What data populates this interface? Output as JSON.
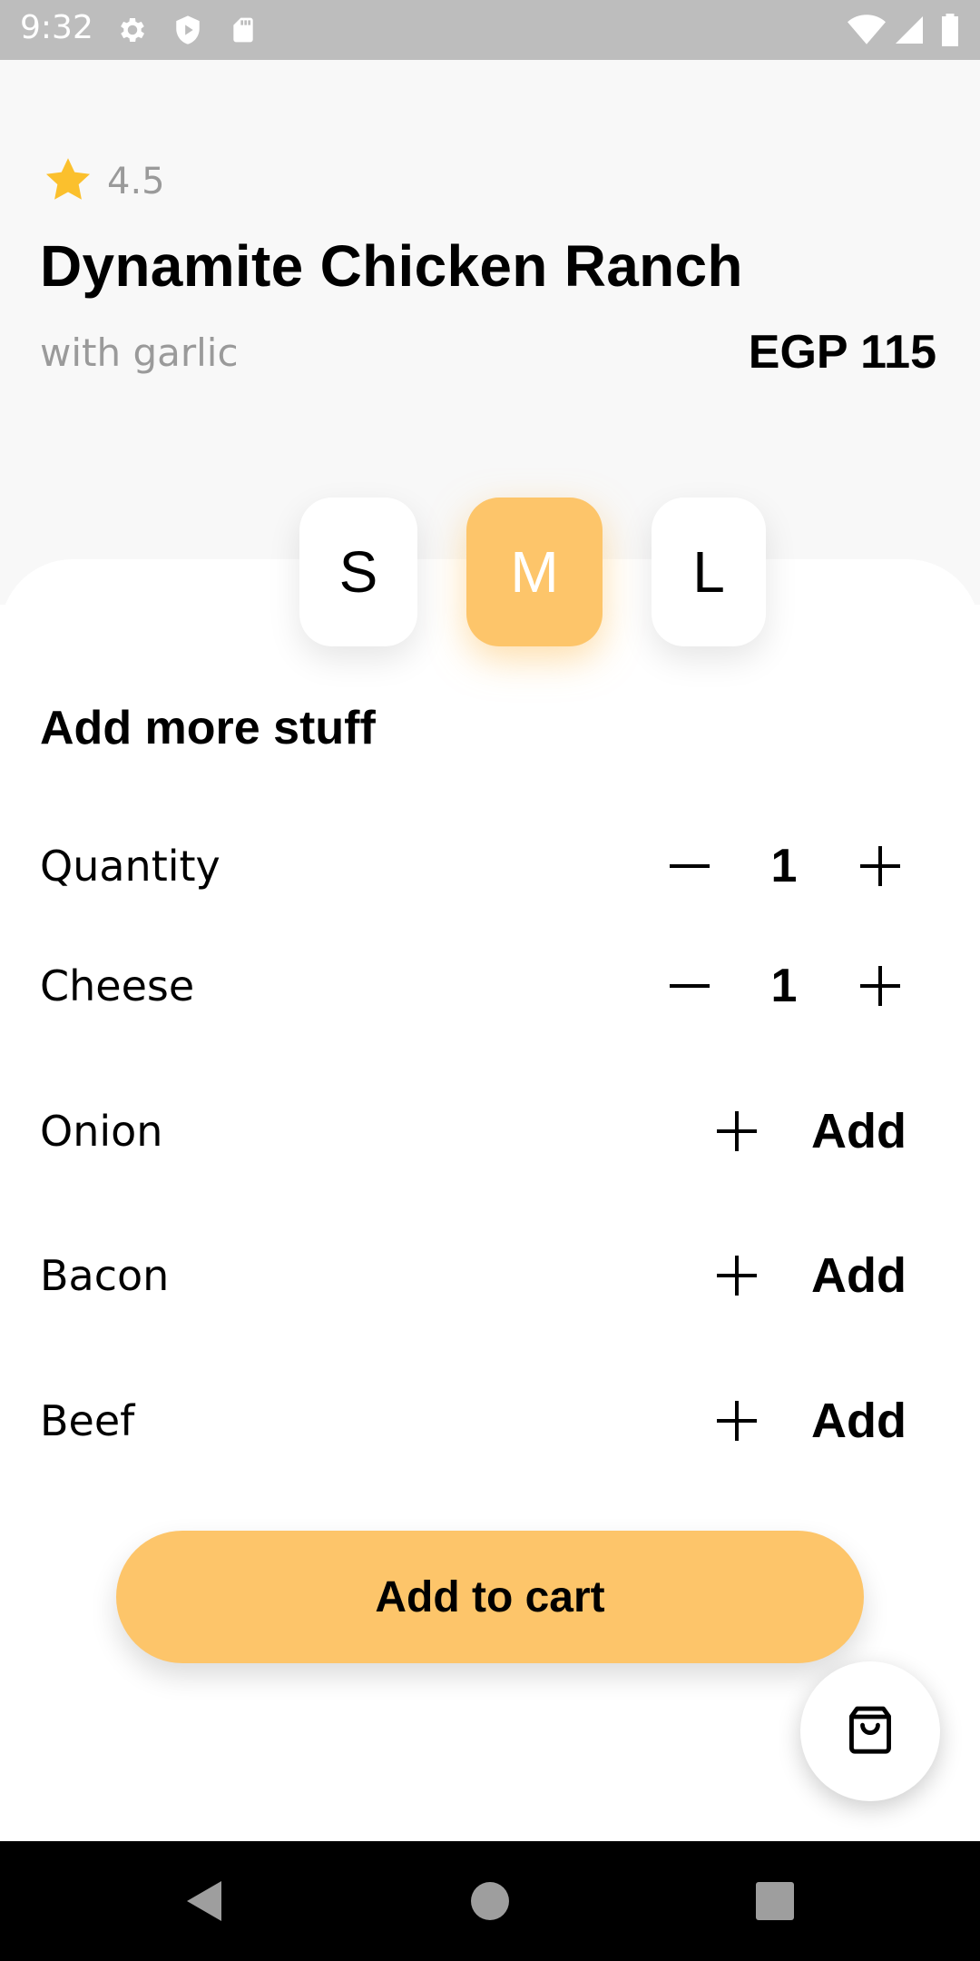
{
  "status_bar": {
    "time": "9:32",
    "left_icons": [
      "gear-icon",
      "shield-icon",
      "sd-card-icon"
    ],
    "right_icons": [
      "wifi-icon",
      "signal-icon",
      "battery-icon"
    ]
  },
  "product": {
    "rating": "4.5",
    "name": "Dynamite Chicken Ranch",
    "subtitle": "with garlic",
    "price": "EGP 115"
  },
  "sizes": {
    "options": [
      "S",
      "M",
      "L"
    ],
    "selected": "M"
  },
  "addons": {
    "title": "Add more stuff",
    "rows": [
      {
        "label": "Quantity",
        "type": "stepper",
        "value": "1"
      },
      {
        "label": "Cheese",
        "type": "stepper",
        "value": "1"
      },
      {
        "label": "Onion",
        "type": "add",
        "action_label": "Add"
      },
      {
        "label": "Bacon",
        "type": "add",
        "action_label": "Add"
      },
      {
        "label": "Beef",
        "type": "add",
        "action_label": "Add"
      }
    ]
  },
  "cart": {
    "button_label": "Add to cart",
    "fab_icon": "shopping-bag-icon"
  },
  "nav_bar": {
    "buttons": [
      "back-icon",
      "home-icon",
      "recents-icon"
    ]
  },
  "colors": {
    "accent": "#fdc56a",
    "star": "#fbc02d",
    "muted_text": "#9a9a9a",
    "status_bar": "#bdbdbd",
    "top_background": "#f8f8f8"
  }
}
